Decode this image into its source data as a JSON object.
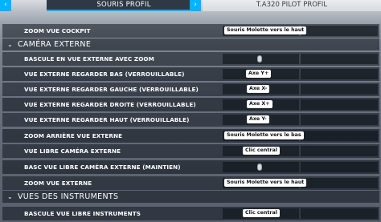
{
  "profile_tabs": {
    "selected": "SOURIS PROFIL",
    "other": "T.A320 PILOT PROFIL",
    "prev_symbol": "‹",
    "next_symbol": "›"
  },
  "rows": [
    {
      "kind": "row",
      "label": "ZOOM VUE COCKPIT",
      "key": "Souris Molette vers le haut"
    },
    {
      "kind": "section",
      "title": "CAMÉRA EXTERNE"
    },
    {
      "kind": "row",
      "label": "BASCULE EN VUE EXTERNE AVEC ZOOM",
      "icon": "mouse-icon"
    },
    {
      "kind": "row",
      "label": "VUE EXTERNE REGARDER BAS (VERROUILLABLE)",
      "key": "Axe Y+"
    },
    {
      "kind": "row",
      "label": "VUE EXTERNE REGARDER GAUCHE (VERROUILLABLE)",
      "key": "Axe X-"
    },
    {
      "kind": "row",
      "label": "VUE EXTERNE REGARDER DROITE (VERROUILLABLE)",
      "key": "Axe X+"
    },
    {
      "kind": "row",
      "label": "VUE EXTERNE REGARDER HAUT (VERROUILLABLE)",
      "key": "Axe Y-"
    },
    {
      "kind": "row",
      "label": "ZOOM ARRIÈRE VUE EXTERNE",
      "key": "Souris Molette vers le bas"
    },
    {
      "kind": "row",
      "label": "VUE LIBRE CAMÉRA EXTERNE",
      "key": "Clic central"
    },
    {
      "kind": "row",
      "label": "BASC VUE LIBRE CAMÉRA EXTERNE (MAINTIEN)",
      "icon": "mouse-icon"
    },
    {
      "kind": "row",
      "label": "ZOOM VUE EXTERNE",
      "key": "Souris Molette vers le haut"
    },
    {
      "kind": "section",
      "title": "VUES DES INSTRUMENTS"
    },
    {
      "kind": "row",
      "label": "BASCULE VUE LIBRE INSTRUMENTS",
      "key": "Clic central"
    }
  ]
}
